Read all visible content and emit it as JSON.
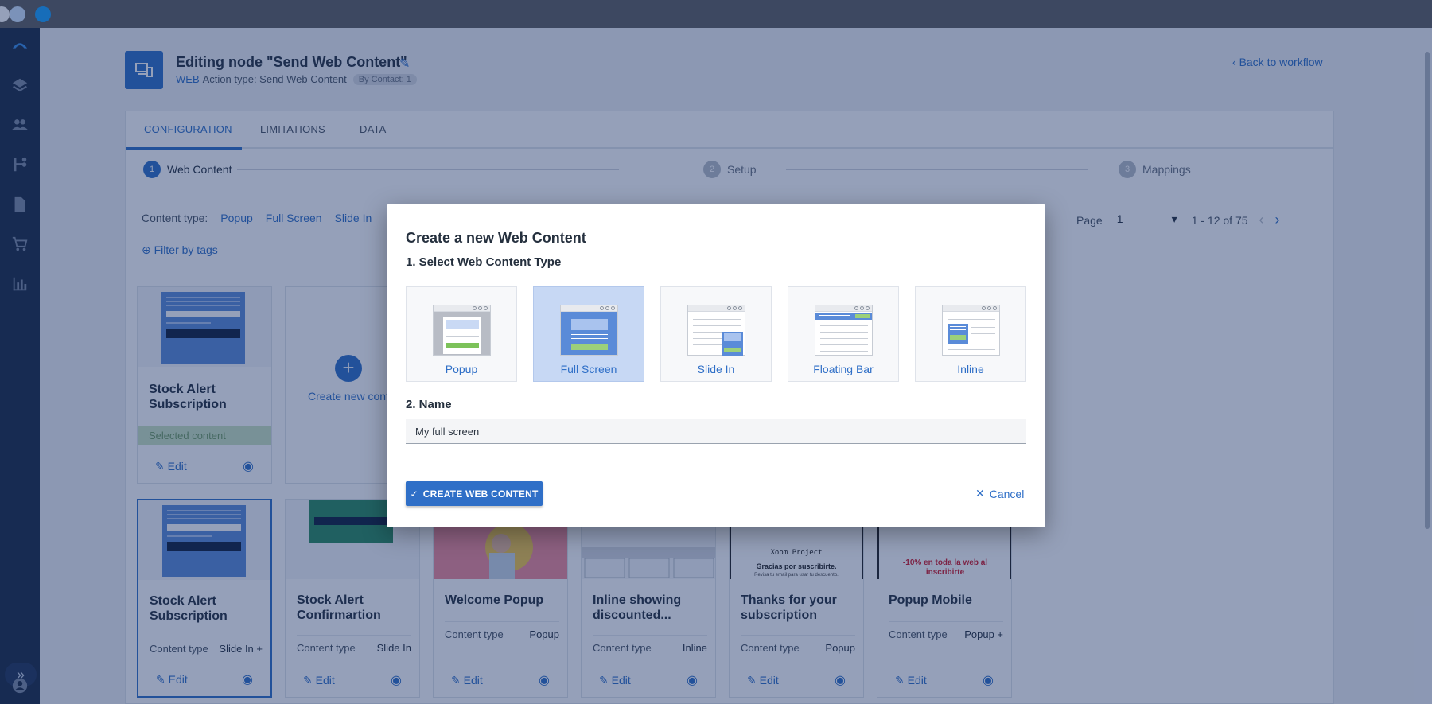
{
  "node": {
    "title": "Editing node \"Send Web Content\"",
    "channel": "WEB",
    "action_type": "Action type: Send Web Content",
    "badge": "By Contact: 1",
    "back_link": "Back to workflow"
  },
  "tabs": [
    {
      "label": "CONFIGURATION",
      "active": true
    },
    {
      "label": "LIMITATIONS",
      "active": false
    },
    {
      "label": "DATA",
      "active": false
    }
  ],
  "steps": [
    {
      "num": "1",
      "label": "Web Content"
    },
    {
      "num": "2",
      "label": "Setup"
    },
    {
      "num": "3",
      "label": "Mappings"
    }
  ],
  "content_type": {
    "label": "Content type:",
    "options": [
      "Popup",
      "Full Screen",
      "Slide In"
    ]
  },
  "filter_tags": "Filter by tags",
  "pager": {
    "label": "Page",
    "page": "1",
    "range": "1 - 12 of 75"
  },
  "cards_row1": [
    {
      "title": "Stock Alert Subscription",
      "selected_label": "Selected content",
      "edit": "Edit"
    },
    {
      "create_label": "Create new cont"
    }
  ],
  "cards_row2": [
    {
      "title": "Stock Alert Subscription",
      "meta_label": "Content type",
      "meta_value": "Slide In +",
      "edit": "Edit"
    },
    {
      "title": "Stock Alert Confirmartion",
      "meta_label": "Content type",
      "meta_value": "Slide In",
      "edit": "Edit"
    },
    {
      "title": "Welcome Popup",
      "meta_label": "Content type",
      "meta_value": "Popup",
      "edit": "Edit"
    },
    {
      "title": "Inline showing discounted...",
      "meta_label": "Content type",
      "meta_value": "Inline",
      "edit": "Edit"
    },
    {
      "title": "Thanks for your subscription",
      "meta_label": "Content type",
      "meta_value": "Popup",
      "edit": "Edit",
      "thumb_lines": [
        "Xoom Project",
        "Gracias por suscribirte.",
        "Revisa tu email para usar tu descuento."
      ]
    },
    {
      "title": "Popup Mobile",
      "meta_label": "Content type",
      "meta_value": "Popup +",
      "edit": "Edit",
      "thumb_lines": [
        "-10% en toda la web al inscribirte"
      ]
    }
  ],
  "modal": {
    "title": "Create a new Web Content",
    "section_type": "1. Select Web Content Type",
    "types": [
      {
        "label": "Popup",
        "active": false
      },
      {
        "label": "Full Screen",
        "active": true
      },
      {
        "label": "Slide In",
        "active": false
      },
      {
        "label": "Floating Bar",
        "active": false
      },
      {
        "label": "Inline",
        "active": false
      }
    ],
    "section_name": "2. Name",
    "name_value": "My full screen",
    "create_button": "CREATE WEB CONTENT",
    "cancel_button": "Cancel"
  },
  "colors": {
    "primary": "#2f6fc7",
    "sidebar": "#1b2a44",
    "overlay": "#142c64",
    "selected_strip": "#cbe3c2"
  }
}
